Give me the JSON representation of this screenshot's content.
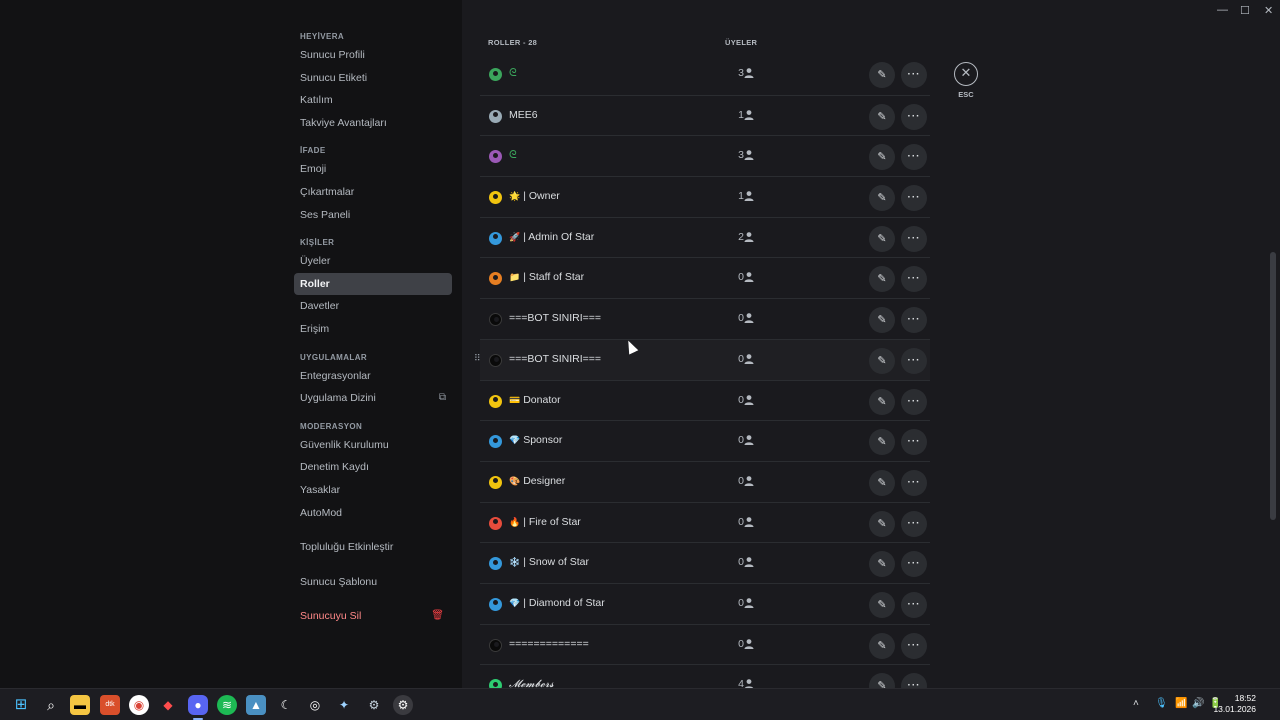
{
  "window": {
    "controls": [
      "—",
      "☐",
      "✕"
    ]
  },
  "sidebar": {
    "sections": [
      {
        "header": "HEYİVERA",
        "items": [
          {
            "label": "Sunucu Profili"
          },
          {
            "label": "Sunucu Etiketi"
          },
          {
            "label": "Katılım"
          },
          {
            "label": "Takviye Avantajları"
          }
        ]
      },
      {
        "header": "İFADE",
        "items": [
          {
            "label": "Emoji"
          },
          {
            "label": "Çıkartmalar"
          },
          {
            "label": "Ses Paneli"
          }
        ]
      },
      {
        "header": "KİŞİLER",
        "items": [
          {
            "label": "Üyeler"
          },
          {
            "label": "Roller",
            "active": true
          },
          {
            "label": "Davetler"
          },
          {
            "label": "Erişim"
          }
        ]
      },
      {
        "header": "UYGULAMALAR",
        "items": [
          {
            "label": "Entegrasyonlar"
          },
          {
            "label": "Uygulama Dizini",
            "external": true
          }
        ]
      },
      {
        "header": "MODERASYON",
        "items": [
          {
            "label": "Güvenlik Kurulumu"
          },
          {
            "label": "Denetim Kaydı"
          },
          {
            "label": "Yasaklar"
          },
          {
            "label": "AutoMod"
          }
        ]
      }
    ],
    "extra_items": [
      {
        "label": "Topluluğu Etkinleştir"
      },
      {
        "label": "Sunucu Şablonu"
      },
      {
        "label": "Sunucuyu Sil",
        "danger": true
      }
    ]
  },
  "main": {
    "roles_header": "ROLLER - 28",
    "members_header": "ÜYELER",
    "roles": [
      {
        "name": "",
        "emoji": "ᘓ",
        "count": "3",
        "color": "#3ba55c"
      },
      {
        "name": "MEE6",
        "emoji": "",
        "count": "1",
        "color": "#99aab5"
      },
      {
        "name": "",
        "emoji": "ᘓ",
        "count": "3",
        "color": "#9b59b6"
      },
      {
        "name": "| Owner",
        "emoji": "🌟",
        "count": "1",
        "color": "#f1c40f"
      },
      {
        "name": "| Admin Of Star",
        "emoji": "🚀",
        "count": "2",
        "color": "#3498db"
      },
      {
        "name": "| Staff of Star",
        "emoji": "📁",
        "count": "0",
        "color": "#e67e22"
      },
      {
        "name": "===BOT SINIRI===",
        "emoji": "",
        "count": "0",
        "color": "#000000"
      },
      {
        "name": "===BOT SINIRI===",
        "emoji": "",
        "count": "0",
        "color": "#000000",
        "hover": true
      },
      {
        "name": "Donator",
        "emoji": "💳",
        "count": "0",
        "color": "#f1c40f"
      },
      {
        "name": "Sponsor",
        "emoji": "💎",
        "count": "0",
        "color": "#3498db"
      },
      {
        "name": "Designer",
        "emoji": "🎨",
        "count": "0",
        "color": "#f1c40f"
      },
      {
        "name": "| Fire of Star",
        "emoji": "🔥",
        "count": "0",
        "color": "#e74c3c"
      },
      {
        "name": "| Snow of Star",
        "emoji": "❄️",
        "count": "0",
        "color": "#3498db"
      },
      {
        "name": "| Diamond of Star",
        "emoji": "💎",
        "count": "0",
        "color": "#3498db"
      },
      {
        "name": "=============",
        "emoji": "",
        "count": "0",
        "color": "#000000"
      },
      {
        "name": "𝓜𝓮𝓶𝓫𝓮𝓻𝓼",
        "emoji": "",
        "count": "4",
        "color": "#2ecc71"
      }
    ],
    "esc_label": "ESC"
  },
  "taskbar": {
    "icons": [
      "start-icon",
      "search-icon",
      "file-explorer-icon",
      "app-icon-1",
      "chrome-icon",
      "app-icon-2",
      "discord-icon",
      "spotify-icon",
      "app-icon-3",
      "app-icon-4",
      "app-icon-5",
      "app-icon-6",
      "steam-icon",
      "settings-icon"
    ],
    "time": "18:52",
    "date": "13.01.2026"
  }
}
